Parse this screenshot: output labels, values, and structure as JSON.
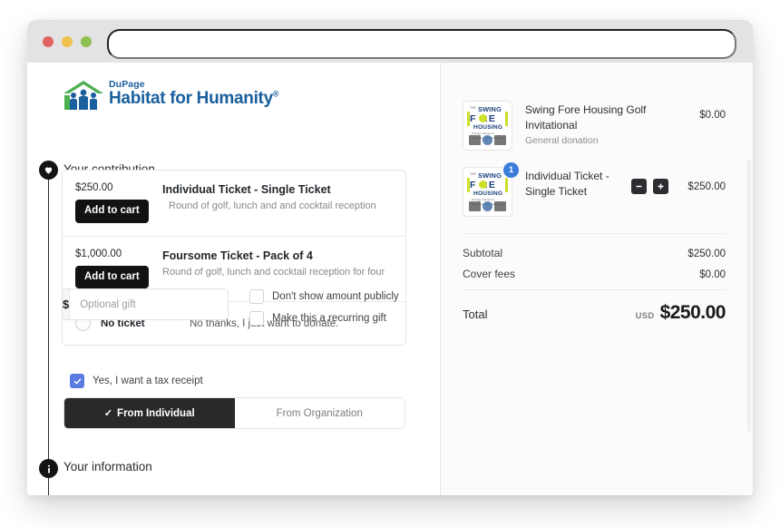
{
  "browser": {
    "traffic_lights": [
      "close-red",
      "minimize-amber",
      "maximize-green"
    ],
    "url_value": "",
    "url_placeholder": ""
  },
  "org": {
    "logo_top": "DuPage",
    "logo_main": "Habitat for Humanity",
    "logo_registered": "®"
  },
  "sections": {
    "contribution": {
      "title": "Your contribution",
      "icon": "heart-icon"
    },
    "information": {
      "title": "Your information",
      "icon": "info-icon"
    }
  },
  "tickets": [
    {
      "price": "$250.00",
      "button": "Add to cart",
      "title": "Individual Ticket - Single Ticket",
      "description": "Round of golf, lunch and and cocktail reception"
    },
    {
      "price": "$1,000.00",
      "button": "Add to cart",
      "title": "Foursome Ticket - Pack of 4",
      "description": "Round of golf, lunch and cocktail reception for four"
    }
  ],
  "no_ticket": {
    "label": "No ticket",
    "description": "No thanks, I just want to donate."
  },
  "gift": {
    "currency_symbol": "$",
    "input_value": "",
    "placeholder": "Optional gift",
    "checkboxes": [
      {
        "label": "Don't show amount publicly",
        "checked": false
      },
      {
        "label": "Make this a recurring gift",
        "checked": false
      }
    ]
  },
  "information": {
    "tax_receipt": {
      "label": "Yes, I want a tax receipt",
      "checked": true
    },
    "toggle": {
      "individual": "From Individual",
      "organization": "From Organization",
      "selected": "From Individual",
      "check_glyph": "✓"
    }
  },
  "cart": {
    "items": [
      {
        "title": "Swing Fore Housing Golf Invitational",
        "subtitle": "General donation",
        "price": "$0.00",
        "badge": "",
        "has_qty": false
      },
      {
        "title": "Individual Ticket - Single Ticket",
        "subtitle": "",
        "price": "$250.00",
        "badge": "1",
        "has_qty": true,
        "decrease_label": "−",
        "increase_label": "+"
      }
    ],
    "thumbnail": {
      "the": "THE",
      "swing": "SWING",
      "fore": "F  RE",
      "housing": "HOUSING",
      "subtext": "DuPage Habitat for Humanity Golf Invitational"
    },
    "summary": [
      {
        "label": "Subtotal",
        "value": "$250.00"
      },
      {
        "label": "Cover fees",
        "value": "$0.00"
      }
    ],
    "total": {
      "label": "Total",
      "currency": "USD",
      "value": "$250.00"
    }
  },
  "colors": {
    "brand_blue": "#1a5f9e",
    "brand_green": "#4caf50",
    "accent_blue": "#3b7ddd",
    "dark": "#111214"
  }
}
